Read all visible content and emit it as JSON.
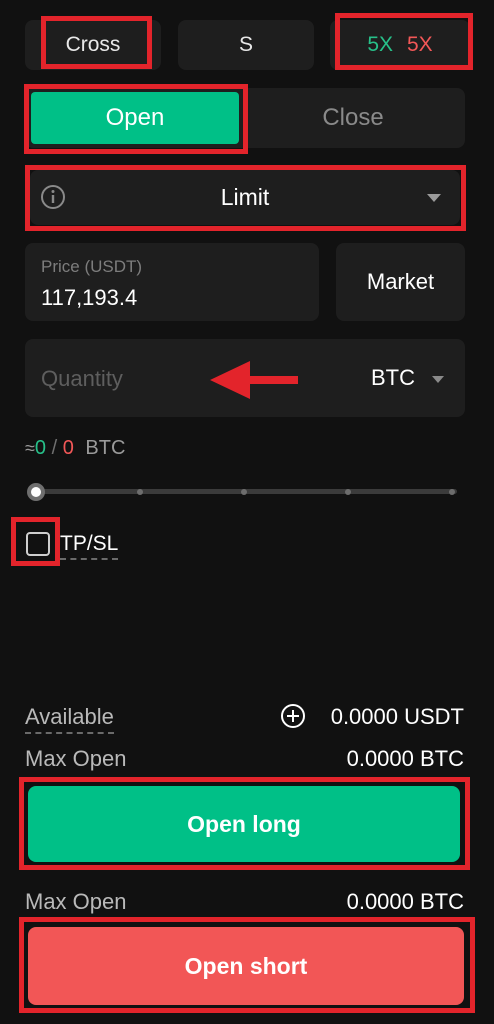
{
  "top": {
    "margin_mode": "Cross",
    "position_side": "S",
    "leverage_long": "5X",
    "leverage_short": "5X"
  },
  "tabs": {
    "open": "Open",
    "close": "Close"
  },
  "order_type": {
    "selected": "Limit",
    "info_icon": "info-circle-icon",
    "caret_icon": "caret-down-icon"
  },
  "price": {
    "label": "Price (USDT)",
    "value": "117,193.4",
    "market_button": "Market"
  },
  "quantity": {
    "placeholder": "Quantity",
    "unit": "BTC"
  },
  "size_readout": {
    "approx": "≈",
    "long": "0",
    "sep": "/",
    "short": "0",
    "unit": "BTC"
  },
  "slider": {
    "value_percent": 0
  },
  "tpsl": {
    "label": "TP/SL",
    "checked": false
  },
  "available": {
    "label": "Available",
    "value": "0.0000 USDT"
  },
  "long_section": {
    "max_open_label": "Max Open",
    "max_open_value": "0.0000 BTC",
    "button": "Open long"
  },
  "short_section": {
    "max_open_label": "Max Open",
    "max_open_value": "0.0000 BTC",
    "button": "Open short"
  },
  "colors": {
    "long": "#00c087",
    "short": "#f25656",
    "highlight": "#e3242b",
    "background": "#111111"
  }
}
